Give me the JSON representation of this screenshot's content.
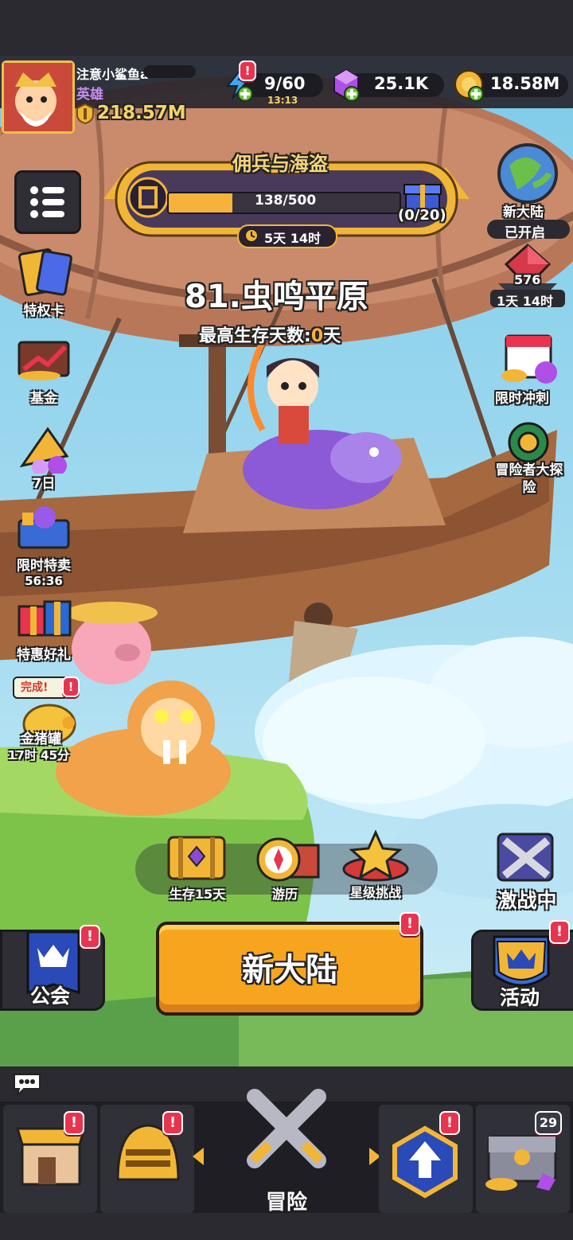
{
  "player": {
    "name": "注意小鲨鱼a",
    "title": "英雄",
    "power": "218.57M"
  },
  "resources": {
    "energy": "9/60",
    "energy_timer": "13:13",
    "gems": "25.1K",
    "coins": "18.58M"
  },
  "event_banner": {
    "title": "佣兵与海盗",
    "progress_text": "138/500",
    "progress": 0.276,
    "reward_count": "(0/20)",
    "timer": "5天 14时"
  },
  "stage": {
    "name": "81.虫鸣平原",
    "best_label": "最高生存天数:",
    "best_value": "0",
    "best_unit": "天"
  },
  "left_side": [
    {
      "label": "特权卡"
    },
    {
      "label": "基金"
    },
    {
      "label": "7日"
    },
    {
      "label": "限时特卖",
      "timer": "56:36"
    },
    {
      "label": "特惠好礼"
    },
    {
      "label": "金猪罐",
      "status": "完成!",
      "timer": "17时 45分"
    }
  ],
  "right_side": {
    "new_continent": {
      "label": "新大陆",
      "status": "已开启"
    },
    "crystal": {
      "count": "576",
      "timer": "1天 14时"
    },
    "sprint": {
      "label": "限时冲刺"
    },
    "explore": {
      "label": "冒险者大探险"
    },
    "battle": {
      "label": "激战中"
    }
  },
  "modes": [
    {
      "label": "生存15天"
    },
    {
      "label": "游历"
    },
    {
      "label": "星级挑战"
    }
  ],
  "buttons": {
    "guild": "公会",
    "main": "新大陆",
    "activity": "活动"
  },
  "badges": {
    "excl": "!",
    "chest_count": "29"
  },
  "nav": {
    "center_label": "冒险"
  },
  "colors": {
    "main_button": "#f7a51f",
    "accent_badge": "#e8344f",
    "banner_purple": "#5a3f7a"
  }
}
